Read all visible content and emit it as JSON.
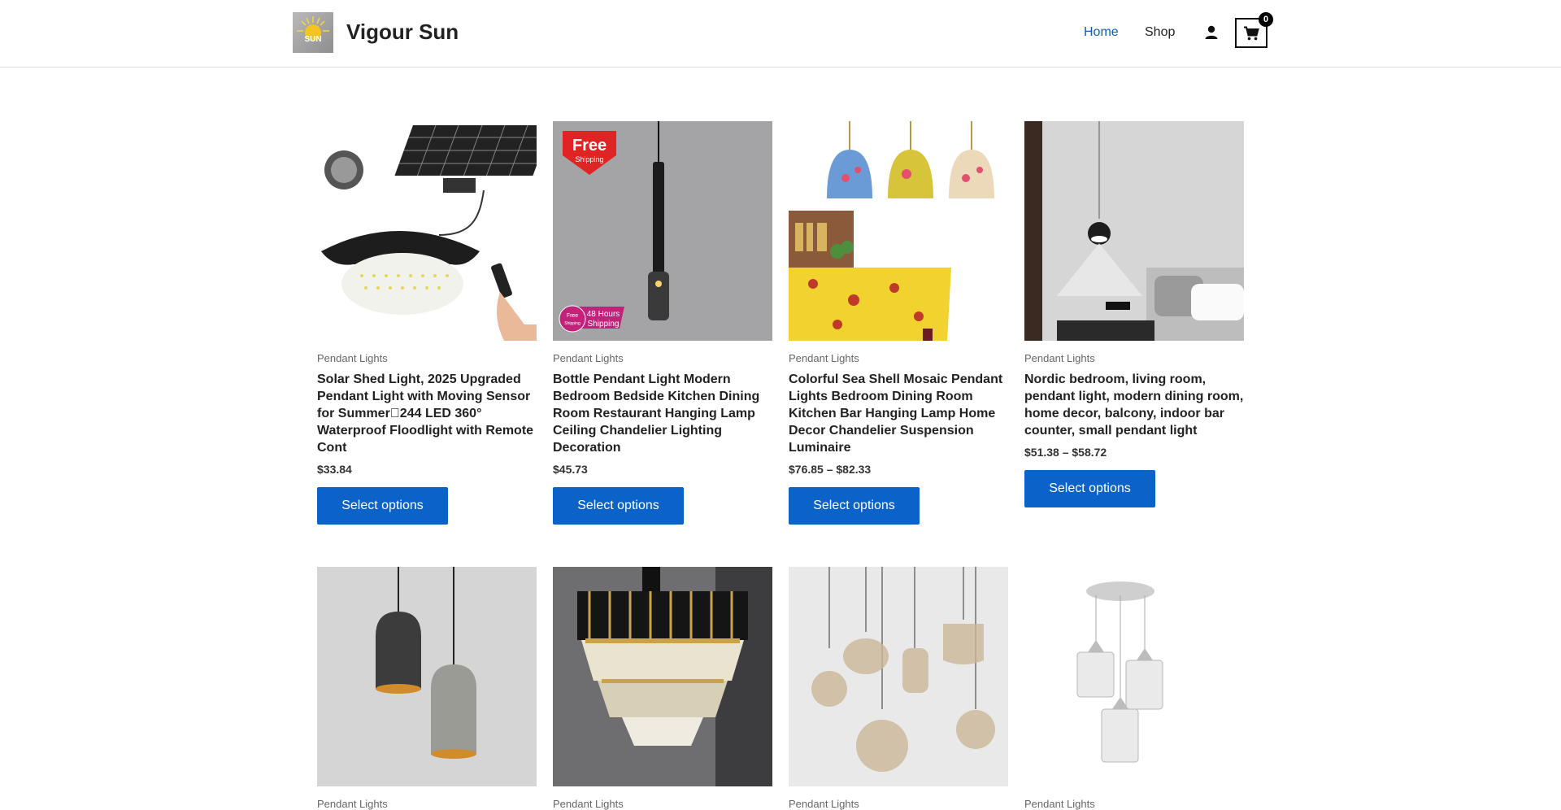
{
  "header": {
    "site_title": "Vigour Sun",
    "logo_text": "SUN",
    "nav": {
      "home": "Home",
      "shop": "Shop"
    },
    "cart_count": "0"
  },
  "products": [
    {
      "category": "Pendant Lights",
      "title": "Solar Shed Light, 2025 Upgraded Pendant Light with Moving Sensor for Summer\u0000244 LED 360° Waterproof Floodlight with Remote Cont",
      "price": "$33.84",
      "button": "Select options"
    },
    {
      "category": "Pendant Lights",
      "title": "Bottle Pendant Light Modern Bedroom Bedside Kitchen Dining Room Restaurant Hanging Lamp Ceiling Chandelier Lighting Decoration",
      "price": "$45.73",
      "button": "Select options",
      "badge_top": "Free",
      "badge_top_sub": "Shipping",
      "badge_bottom_circle": "Free",
      "badge_bottom_circle_sub": "Shipping",
      "badge_bottom": "48 Hours",
      "badge_bottom_sub": "Shipping"
    },
    {
      "category": "Pendant Lights",
      "title": "Colorful Sea Shell Mosaic Pendant Lights Bedroom Dining Room Kitchen Bar Hanging Lamp Home Decor Chandelier Suspension Luminaire",
      "price": "$76.85 – $82.33",
      "button": "Select options"
    },
    {
      "category": "Pendant Lights",
      "title": "Nordic bedroom, living room, pendant light, modern dining room, home decor, balcony, indoor bar counter, small pendant light",
      "price": "$51.38 – $58.72",
      "button": "Select options"
    },
    {
      "category": "Pendant Lights"
    },
    {
      "category": "Pendant Lights"
    },
    {
      "category": "Pendant Lights"
    },
    {
      "category": "Pendant Lights"
    }
  ],
  "colors": {
    "accent": "#0b63c9",
    "nav_active": "#0a5fb5"
  }
}
